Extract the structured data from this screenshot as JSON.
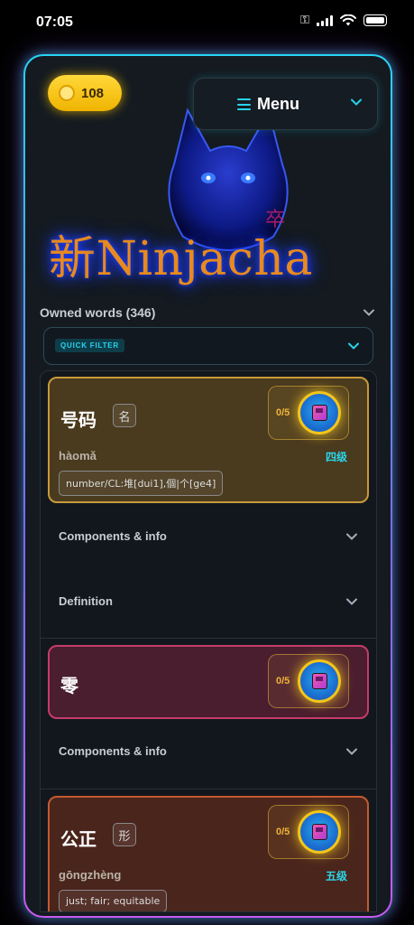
{
  "status": {
    "time": "07:05"
  },
  "header": {
    "coins": "108",
    "menu_label": "Menu"
  },
  "logo": {
    "hanzi": "新",
    "name": "Ninjacha",
    "stamp": "卒"
  },
  "owned": {
    "label": "Owned words (346)",
    "quick_filter": "QUICK FILTER"
  },
  "rows": {
    "components": "Components & info",
    "definition": "Definition"
  },
  "words": [
    {
      "hanzi": "号码",
      "pos": "名",
      "pinyin": "hàomǎ",
      "level": "四级",
      "definition": "number/CL:堆[dui1],個|个[ge4]",
      "progress": "0/5",
      "color": "#c99a3a"
    },
    {
      "hanzi": "零",
      "progress": "0/5",
      "color": "#c53b6a"
    },
    {
      "hanzi": "公正",
      "pos": "形",
      "pinyin": "gōngzhèng",
      "level": "五级",
      "definition": "just; fair; equitable",
      "progress": "0/5",
      "color": "#c45a2e"
    }
  ]
}
